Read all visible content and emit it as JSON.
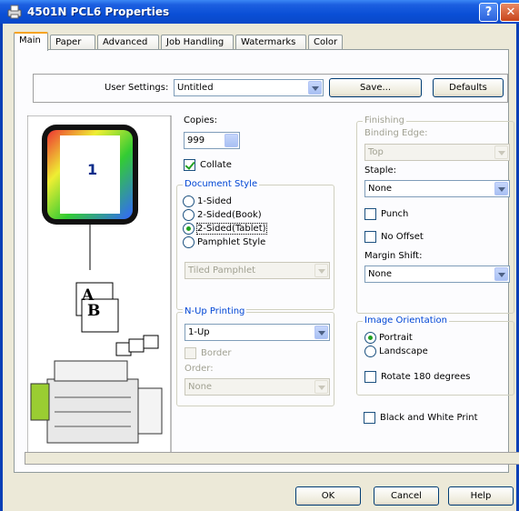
{
  "window": {
    "title": "4501N PCL6 Properties",
    "help_glyph": "?",
    "close_glyph": "✕"
  },
  "tabs": [
    "Main",
    "Paper",
    "Advanced",
    "Job Handling",
    "Watermarks",
    "Color"
  ],
  "user_settings": {
    "label": "User Settings:",
    "value": "Untitled",
    "save_label": "Save...",
    "defaults_label": "Defaults"
  },
  "preview": {
    "page_number": "1",
    "sheet_a": "A",
    "sheet_b": "B"
  },
  "copies": {
    "label": "Copies:",
    "value": "999",
    "collate_label": "Collate",
    "collate_checked": true
  },
  "document_style": {
    "title": "Document Style",
    "options": [
      "1-Sided",
      "2-Sided(Book)",
      "2-Sided(Tablet)",
      "Pamphlet Style"
    ],
    "selected": "2-Sided(Tablet)",
    "pamphlet_value": "Tiled Pamphlet"
  },
  "nup": {
    "title": "N-Up Printing",
    "value": "1-Up",
    "border_label": "Border",
    "order_label": "Order:",
    "order_value": "None"
  },
  "finishing": {
    "title": "Finishing",
    "binding_label": "Binding Edge:",
    "binding_value": "Top",
    "staple_label": "Staple:",
    "staple_value": "None",
    "punch_label": "Punch",
    "no_offset_label": "No Offset",
    "margin_label": "Margin Shift:",
    "margin_value": "None"
  },
  "orientation": {
    "title": "Image Orientation",
    "portrait_label": "Portrait",
    "landscape_label": "Landscape",
    "selected": "Portrait",
    "rotate_label": "Rotate 180 degrees"
  },
  "bw_label": "Black and White Print",
  "footer": {
    "ok": "OK",
    "cancel": "Cancel",
    "help": "Help"
  },
  "colors": {
    "title_bar": "#0a4fd6",
    "dialog": "#ece9d8",
    "group_title": "#0046d5",
    "check": "#21a121"
  }
}
